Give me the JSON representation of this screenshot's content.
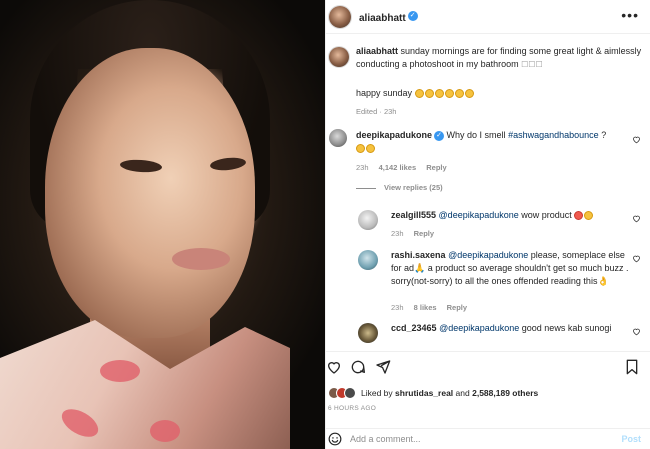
{
  "post": {
    "author": "aliaabhatt",
    "verified_glyph": "✓",
    "more_glyph": "•••"
  },
  "caption": {
    "username": "aliaabhatt",
    "text": "sunday mornings are for finding some great light & aimlessly conducting a photoshoot in my bathroom",
    "text_emoji": "☐☐☐",
    "second_line": "happy sunday",
    "edited": "Edited",
    "time": "23h"
  },
  "comments": [
    {
      "username": "deepikapadukone",
      "verified": true,
      "text": "Why do I smell",
      "hashtag": "#ashwagandhabounce",
      "suffix": "?",
      "time": "23h",
      "likes": "4,142 likes",
      "reply": "Reply"
    }
  ],
  "view_replies": "View replies (25)",
  "replies": [
    {
      "username": "zealgill555",
      "mention": "@deepikapadukone",
      "text": "wow product",
      "time": "23h",
      "reply": "Reply"
    },
    {
      "username": "rashi.saxena",
      "mention": "@deepikapadukone",
      "text": "please, someplace else for ad🙏 a product so average shouldn't get so much buzz . sorry(not-sorry) to all the ones offended reading this👌",
      "time": "23h",
      "likes": "8 likes",
      "reply": "Reply"
    },
    {
      "username": "ccd_23465",
      "mention": "@deepikapadukone",
      "text": "good news kab sunogi"
    }
  ],
  "actions": {
    "icons": [
      "heart-icon",
      "comment-icon",
      "share-icon",
      "bookmark-icon"
    ]
  },
  "likes": {
    "prefix": "Liked by",
    "user": "shrutidas_real",
    "middle": "and",
    "count": "2,588,189 others"
  },
  "timestamp": "6 HOURS AGO",
  "composer": {
    "placeholder": "Add a comment...",
    "post_label": "Post"
  },
  "colors": {
    "link": "#00376b",
    "muted": "#8e8e8e",
    "verified": "#3897f0",
    "post_disabled": "#b2dffc"
  }
}
